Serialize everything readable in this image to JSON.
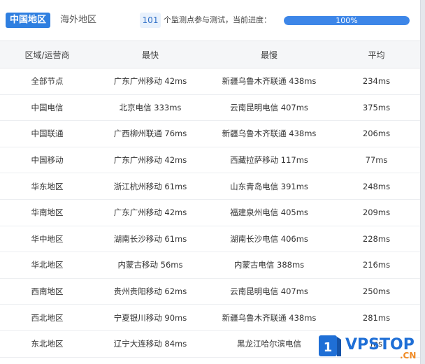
{
  "tabs": [
    {
      "label": "中国地区",
      "active": true
    },
    {
      "label": "海外地区",
      "active": false
    }
  ],
  "progress": {
    "count": "101",
    "text": "个监测点参与测试，当前进度：",
    "percent_label": "100%",
    "fraction": 1.0
  },
  "table": {
    "headers": [
      "区域/运营商",
      "最快",
      "最慢",
      "平均"
    ],
    "rows": [
      [
        "全部节点",
        "广东广州移动 42ms",
        "新疆乌鲁木齐联通 438ms",
        "234ms"
      ],
      [
        "中国电信",
        "北京电信 333ms",
        "云南昆明电信 407ms",
        "375ms"
      ],
      [
        "中国联通",
        "广西柳州联通 76ms",
        "新疆乌鲁木齐联通 438ms",
        "206ms"
      ],
      [
        "中国移动",
        "广东广州移动 42ms",
        "西藏拉萨移动 117ms",
        "77ms"
      ],
      [
        "华东地区",
        "浙江杭州移动 61ms",
        "山东青岛电信 391ms",
        "248ms"
      ],
      [
        "华南地区",
        "广东广州移动 42ms",
        "福建泉州电信 405ms",
        "209ms"
      ],
      [
        "华中地区",
        "湖南长沙移动 61ms",
        "湖南长沙电信 406ms",
        "228ms"
      ],
      [
        "华北地区",
        "内蒙古移动 56ms",
        "内蒙古电信 388ms",
        "216ms"
      ],
      [
        "西南地区",
        "贵州贵阳移动 62ms",
        "云南昆明电信 407ms",
        "250ms"
      ],
      [
        "西北地区",
        "宁夏银川移动 90ms",
        "新疆乌鲁木齐联通 438ms",
        "281ms"
      ],
      [
        "东北地区",
        "辽宁大连移动 84ms",
        "黑龙江哈尔滨电信 ",
        "ms"
      ]
    ]
  },
  "watermark": {
    "number": "1",
    "brand": "VPSTOP",
    "suffix": ".CN",
    "colors": {
      "blue": "#1f6fd6",
      "orange": "#f08a24"
    }
  },
  "colors": {
    "accent": "#2f7fe0",
    "progress_fill": "#3d86e8",
    "header_bg": "#f5f6f8"
  }
}
